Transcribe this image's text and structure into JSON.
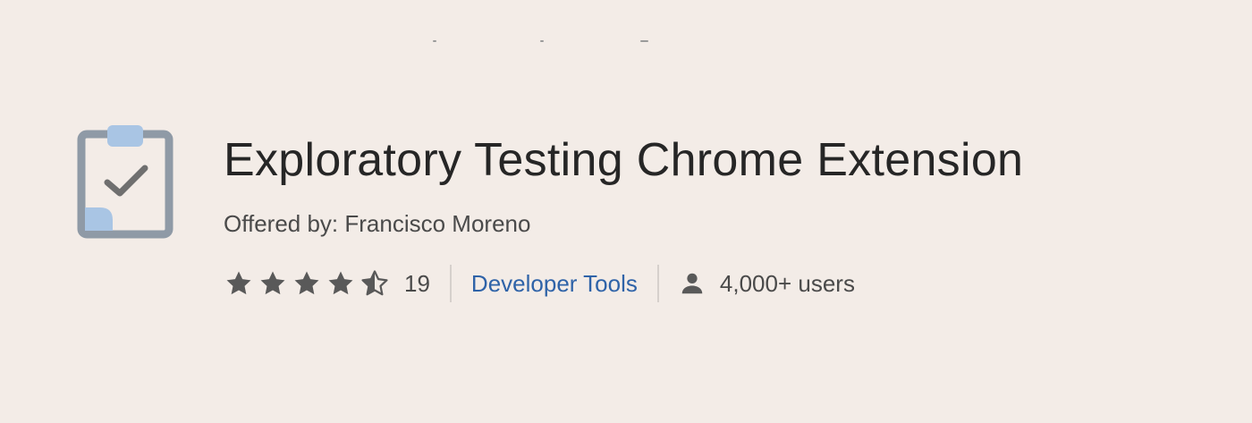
{
  "extension": {
    "title": "Exploratory Testing Chrome Extension",
    "offered_by": "Offered by: Francisco Moreno",
    "rating_count": "19",
    "rating_value": 4.5,
    "category": "Developer Tools",
    "users": "4,000+ users",
    "logo_icon": "clipboard-check-icon"
  },
  "colors": {
    "background": "#f3ece7",
    "category_link": "#2f63a8",
    "logo_frame": "#8f9aa6",
    "logo_accent": "#a9c5e4"
  }
}
